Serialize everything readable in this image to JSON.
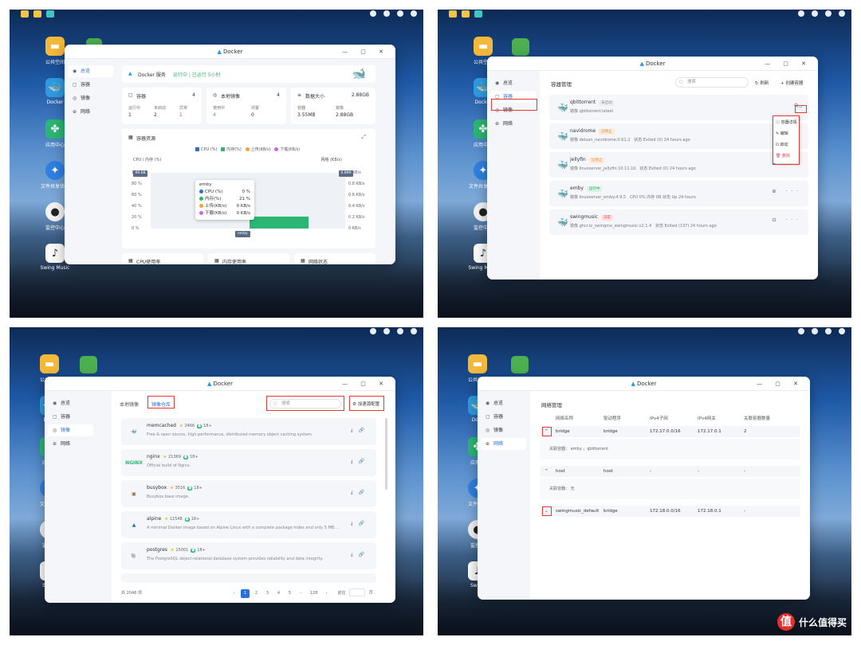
{
  "window_title": "Docker",
  "desktop": {
    "icons": [
      {
        "label": "公共空间",
        "icon": "public-space-icon"
      },
      {
        "label": "Docker",
        "icon": "docker-icon"
      },
      {
        "label": "应用中心",
        "icon": "app-center-icon"
      },
      {
        "label": "文件共享协议",
        "icon": "file-share-icon"
      },
      {
        "label": "监控中心",
        "icon": "monitor-icon"
      },
      {
        "label": "Swing Music",
        "icon": "swing-music-icon"
      }
    ],
    "clipped_labels": {
      "docker": "Dock",
      "app": "应用中",
      "share": "文件共享",
      "monitor": "监控中",
      "swing": "Swing"
    }
  },
  "sidebar": [
    "总览",
    "容器",
    "镜像",
    "网络"
  ],
  "overview": {
    "service_label": "Docker 服务",
    "service_status": "运行中 | 已运行 5小时",
    "containers": {
      "title": "容器",
      "total": "4",
      "k1": "运行中",
      "v1": "1",
      "k2": "未启动",
      "v2": "2",
      "k3": "异常",
      "v3": "1"
    },
    "images": {
      "title": "本地镜像",
      "total": "4",
      "k1": "使用中",
      "v1": "4",
      "k2": "闲置",
      "v2": "0"
    },
    "data": {
      "title": "数据大小",
      "total": "2.88GB",
      "k1": "容器",
      "v1": "3.55MB",
      "k2": "镜像",
      "v2": "2.88GB"
    },
    "resources": {
      "title": "容器资源",
      "legend": [
        "CPU (%)",
        "内存(%)",
        "上传(KB/s)",
        "下载(KB/s)"
      ],
      "left_axis": "CPU / 内存 (%)",
      "right_axis": "网络 (KB/s)",
      "left_ticks": [
        "100 %",
        "80 %",
        "60 %",
        "40 %",
        "20 %",
        "0 %"
      ],
      "right_ticks": [
        "1 KB/s",
        "0.8 KB/s",
        "0.6 KB/s",
        "0.4 KB/s",
        "0.2 KB/s",
        "0 KB/s"
      ],
      "left_marker": "99.88",
      "right_marker": "0.899",
      "x_label": "emby",
      "tooltip": {
        "name": "emby",
        "rows": [
          {
            "k": "CPU (%)",
            "v": "0 %"
          },
          {
            "k": "内存(%)",
            "v": "21 %"
          },
          {
            "k": "上传(KB/s)",
            "v": "0 KB/s"
          },
          {
            "k": "下载(KB/s)",
            "v": "0 KB/s"
          }
        ]
      }
    },
    "bottom_cards": [
      "CPU使用率",
      "内存使用率",
      "网络状态"
    ]
  },
  "containers_page": {
    "title": "容器管理",
    "search_placeholder": "搜索",
    "refresh": "刷新",
    "create": "+ 创建容器",
    "list": [
      {
        "name": "qbittorrent",
        "badge": "未启动",
        "image": "镜像  qbittorrent:latest",
        "info": ""
      },
      {
        "name": "navidrome",
        "badge": "已停止",
        "image": "镜像  deluan_navidrome:0.61.2",
        "info": "状态   Exited (0) 24 hours ago"
      },
      {
        "name": "jellyfin",
        "badge": "已停止",
        "image": "镜像  linuxserver_jellyfin:10.11.10",
        "info": "状态   Exited (0) 24 hours ago"
      },
      {
        "name": "emby",
        "badge": "运行中",
        "image": "镜像  linuxserver_emby:4.9.5",
        "info": "CPU  0%   内存  0B   状态   Up 24 hours"
      },
      {
        "name": "swingmusic",
        "badge": "异常",
        "image": "镜像  ghcr.io_swingmx_swingmusic:v2.1.4",
        "info": "状态   Exited (137) 24 hours ago"
      }
    ],
    "menu": [
      "容器详情",
      "编辑",
      "启动",
      "删除"
    ]
  },
  "images_page": {
    "tabs": [
      "本地镜像",
      "镜像仓库"
    ],
    "search_placeholder": "搜索",
    "accelerate": "加速源配置",
    "list": [
      {
        "name": "memcached",
        "stars": "2466",
        "age": "18+",
        "desc": "Free & open source, high-performance, distributed memory object caching system."
      },
      {
        "name": "nginx",
        "stars": "21369",
        "age": "18+",
        "desc": "Official build of Nginx."
      },
      {
        "name": "busybox",
        "stars": "3516",
        "age": "18+",
        "desc": "Busybox base image."
      },
      {
        "name": "alpine",
        "stars": "11548",
        "age": "18+",
        "desc": "A minimal Docker image based on Alpine Linux with a complete package index and only 5 MB ..."
      },
      {
        "name": "postgres",
        "stars": "15001",
        "age": "18+",
        "desc": "The PostgreSQL object-relational database system provides reliability and data integrity."
      }
    ],
    "total": "共 2048 项",
    "pages": [
      "1",
      "2",
      "3",
      "4",
      "5",
      "···",
      "128"
    ],
    "goto": "前往",
    "page_unit": "页"
  },
  "network_page": {
    "title": "网络管理",
    "headers": [
      "网络名称",
      "驱动程序",
      "IPv4子网",
      "IPv4网关",
      "关联容器数量"
    ],
    "rows": [
      {
        "name": "bridge",
        "driver": "bridge",
        "subnet": "172.17.0.0/16",
        "gateway": "172.17.0.1",
        "count": "2",
        "assoc": "关联容器：  emby ，qbittorrent"
      },
      {
        "name": "host",
        "driver": "host",
        "subnet": "-",
        "gateway": "-",
        "count": "-",
        "assoc": "关联容器：  无"
      },
      {
        "name": "swingmusic_default",
        "driver": "bridge",
        "subnet": "172.18.0.0/16",
        "gateway": "172.18.0.1",
        "count": "-",
        "assoc": ""
      }
    ]
  },
  "watermark": "什么值得买",
  "colors": {
    "accent": "#2c6fd6",
    "cpu": "#2c6fd6",
    "mem": "#2bb673",
    "up": "#f2a33a",
    "down": "#c86bd9",
    "highlight": "#e53935"
  }
}
